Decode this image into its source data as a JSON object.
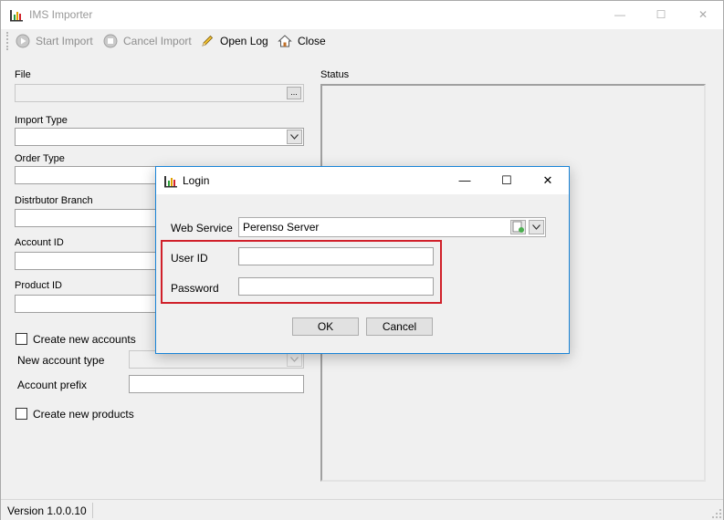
{
  "window": {
    "title": "IMS Importer",
    "minimize": "—",
    "maximize": "☐",
    "close": "✕"
  },
  "toolbar": {
    "start_import": "Start Import",
    "cancel_import": "Cancel Import",
    "open_log": "Open Log",
    "close": "Close"
  },
  "form": {
    "file_label": "File",
    "browse_label": "...",
    "import_type_label": "Import Type",
    "order_type_label": "Order Type",
    "distributor_branch_label": "Distrbutor Branch",
    "account_id_label": "Account ID",
    "product_id_label": "Product ID",
    "create_new_accounts_label": "Create new accounts",
    "new_account_type_label": "New account type",
    "account_prefix_label": "Account prefix",
    "create_new_products_label": "Create new products"
  },
  "status": {
    "label": "Status"
  },
  "statusbar": {
    "version": "Version 1.0.0.10"
  },
  "login_dialog": {
    "title": "Login",
    "minimize": "—",
    "maximize": "☐",
    "close": "✕",
    "web_service_label": "Web Service",
    "web_service_value": "Perenso Server",
    "user_id_label": "User ID",
    "user_id_value": "",
    "password_label": "Password",
    "password_value": "",
    "ok_label": "OK",
    "cancel_label": "Cancel",
    "highlight_color": "#d0202a"
  }
}
